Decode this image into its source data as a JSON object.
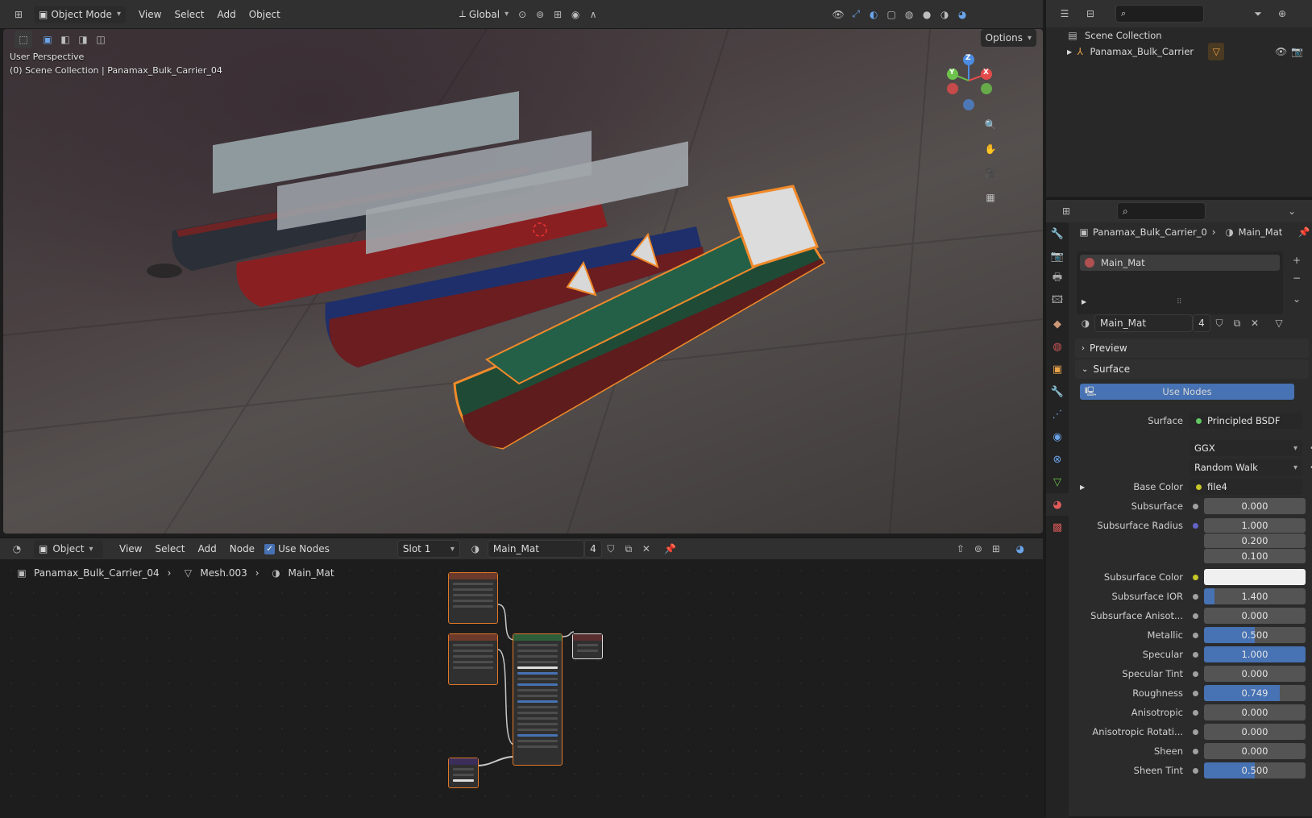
{
  "viewport": {
    "header": {
      "mode": "Object Mode",
      "menus": [
        "View",
        "Select",
        "Add",
        "Object"
      ],
      "orientation": "Global",
      "options": "Options"
    },
    "overlay_line1": "User Perspective",
    "overlay_line2": "(0) Scene Collection | Panamax_Bulk_Carrier_04",
    "gizmo": {
      "x": "X",
      "y": "Y",
      "z": "Z"
    }
  },
  "node_editor": {
    "header": {
      "object_mode": "Object",
      "menus": [
        "View",
        "Select",
        "Add",
        "Node"
      ],
      "use_nodes": "Use Nodes",
      "slot": "Slot 1",
      "material": "Main_Mat",
      "users": "4"
    },
    "breadcrumb": [
      "Panamax_Bulk_Carrier_04",
      "Mesh.003",
      "Main_Mat"
    ]
  },
  "outliner": {
    "root": "Scene Collection",
    "items": [
      {
        "label": "Panamax_Bulk_Carrier"
      }
    ]
  },
  "properties": {
    "breadcrumb_object": "Panamax_Bulk_Carrier_0",
    "breadcrumb_material": "Main_Mat",
    "slot_item": "Main_Mat",
    "material_name": "Main_Mat",
    "material_users": "4",
    "preview_label": "Preview",
    "surface_label": "Surface",
    "use_nodes_button": "Use Nodes",
    "surface_field_label": "Surface",
    "surface_shader": "Principled BSDF",
    "distribution": "GGX",
    "subsurface_method": "Random Walk",
    "base_color_label": "Base Color",
    "base_color_value": "file4",
    "subsurface_radius_label": "Subsurface Radius",
    "subsurface_radius": [
      "1.000",
      "0.200",
      "0.100"
    ],
    "subsurface_color_label": "Subsurface Color",
    "subsurface_color": "#f0f0f0",
    "rows": [
      {
        "label": "Subsurface",
        "value": "0.000",
        "fill": 0
      },
      {
        "label": "Subsurface IOR",
        "value": "1.400",
        "fill": 0.1
      },
      {
        "label": "Subsurface Anisot...",
        "value": "0.000",
        "fill": 0
      },
      {
        "label": "Metallic",
        "value": "0.500",
        "fill": 0.5
      },
      {
        "label": "Specular",
        "value": "1.000",
        "fill": 1.0
      },
      {
        "label": "Specular Tint",
        "value": "0.000",
        "fill": 0
      },
      {
        "label": "Roughness",
        "value": "0.749",
        "fill": 0.749
      },
      {
        "label": "Anisotropic",
        "value": "0.000",
        "fill": 0
      },
      {
        "label": "Anisotropic Rotati...",
        "value": "0.000",
        "fill": 0
      },
      {
        "label": "Sheen",
        "value": "0.000",
        "fill": 0
      },
      {
        "label": "Sheen Tint",
        "value": "0.500",
        "fill": 0.5
      }
    ]
  },
  "colors": {
    "accent": "#4772b3",
    "selection": "#e07828",
    "ship_hulls": [
      "#2a2f38",
      "#8a1f22",
      "#1e2f6b",
      "#1f4a36"
    ]
  }
}
